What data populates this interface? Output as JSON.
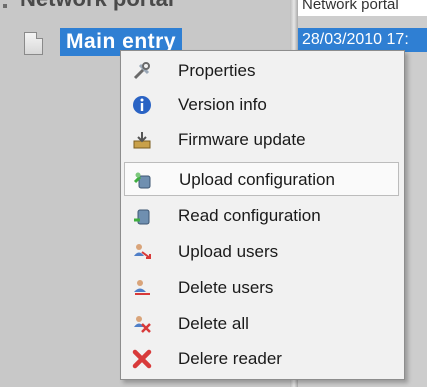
{
  "tree": {
    "root_label": "Network portal",
    "selected_item": "Main entry"
  },
  "list": {
    "header_text": "Network portal",
    "row_text": "28/03/2010 17:"
  },
  "context_menu": {
    "items": [
      {
        "label": "Properties",
        "icon": "properties-icon"
      },
      {
        "label": "Version info",
        "icon": "info-icon"
      },
      {
        "label": "Firmware update",
        "icon": "firmware-icon"
      },
      {
        "label": "Upload configuration",
        "icon": "upload-config-icon",
        "highlighted": true
      },
      {
        "label": "Read configuration",
        "icon": "read-config-icon"
      },
      {
        "label": "Upload users",
        "icon": "upload-users-icon"
      },
      {
        "label": "Delete users",
        "icon": "delete-users-icon"
      },
      {
        "label": "Delete all",
        "icon": "delete-all-icon"
      },
      {
        "label": "Delere reader",
        "icon": "delete-reader-icon"
      }
    ]
  },
  "colors": {
    "selection": "#2f7fd3",
    "menu_background": "#f1f1f1",
    "pane_background": "#c8c8c8"
  }
}
